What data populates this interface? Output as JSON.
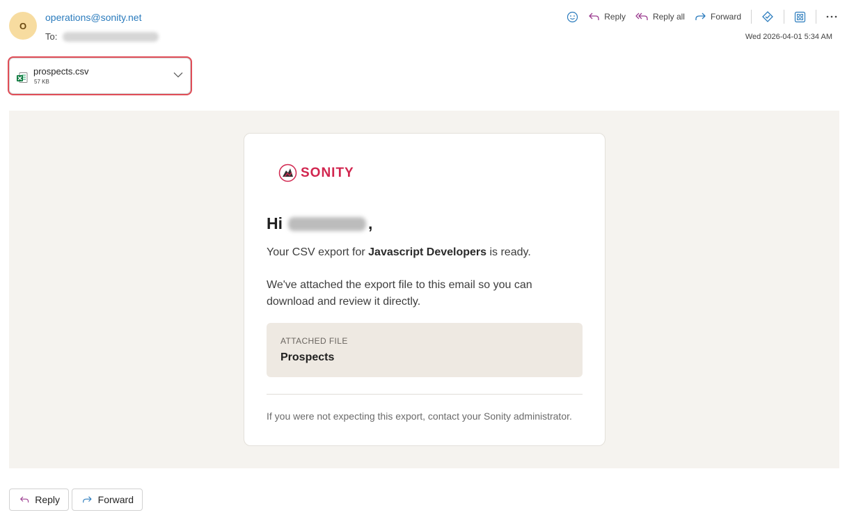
{
  "header": {
    "avatar_initial": "O",
    "sender": "operations@sonity.net",
    "to_label": "To:",
    "date": "Wed 2026-04-01 5:34 AM"
  },
  "toolbar": {
    "reply": "Reply",
    "reply_all": "Reply all",
    "forward": "Forward"
  },
  "attachment": {
    "name": "prospects.csv",
    "size": "57 KB"
  },
  "email": {
    "brand": "SONITY",
    "greeting_prefix": "Hi",
    "greeting_suffix": ",",
    "line1_prefix": "Your CSV export for ",
    "line1_bold": "Javascript Developers",
    "line1_suffix": " is ready.",
    "line2": "We've attached the export file to this email so you can download and review it directly.",
    "file_label": "ATTACHED FILE",
    "file_value": "Prospects",
    "footer_note": "If you were not expecting this export, contact your Sonity administrator."
  },
  "footer": {
    "reply": "Reply",
    "forward": "Forward"
  },
  "colors": {
    "accent": "#2a7bbd",
    "brand": "#d1264f",
    "highlight": "#e04d57"
  }
}
